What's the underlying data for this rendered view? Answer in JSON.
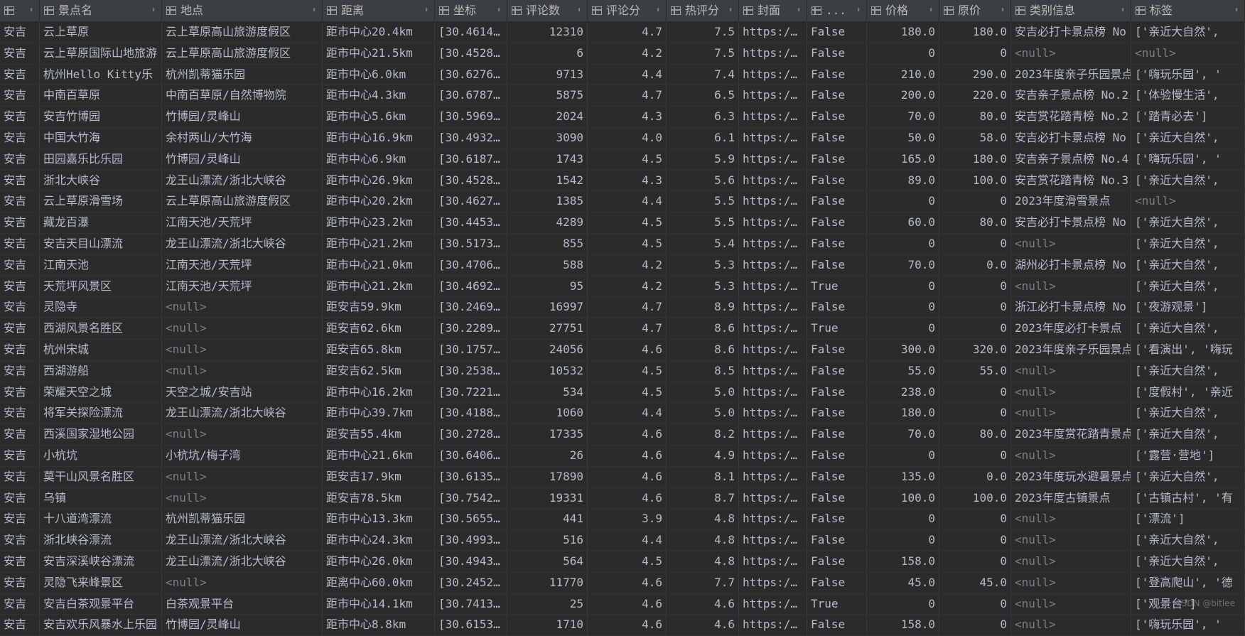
{
  "columns": [
    {
      "label": "",
      "icon": "table-icon"
    },
    {
      "label": "景点名",
      "icon": "column-icon"
    },
    {
      "label": "地点",
      "icon": "column-icon"
    },
    {
      "label": "距离",
      "icon": "column-icon"
    },
    {
      "label": "坐标",
      "icon": "column-icon"
    },
    {
      "label": "评论数",
      "icon": "column-icon"
    },
    {
      "label": "评论分",
      "icon": "column-icon"
    },
    {
      "label": "热评分",
      "icon": "column-icon"
    },
    {
      "label": "封面",
      "icon": "column-icon"
    },
    {
      "label": "...",
      "icon": "column-icon"
    },
    {
      "label": "价格",
      "icon": "column-icon"
    },
    {
      "label": "原价",
      "icon": "column-icon"
    },
    {
      "label": "类别信息",
      "icon": "column-icon"
    },
    {
      "label": "标签",
      "icon": "column-icon"
    }
  ],
  "numeric_columns": [
    5,
    6,
    7,
    10,
    11
  ],
  "null_text": "<null>",
  "rows": [
    [
      "安吉",
      "云上草原",
      "云上草原高山旅游度假区",
      "距市中心20.4km",
      "[30.4614…",
      "12310",
      "4.7",
      "7.5",
      "https:/…",
      "False",
      "180.0",
      "180.0",
      "安吉必打卡景点榜 No",
      "['亲近大自然',"
    ],
    [
      "安吉",
      "云上草原国际山地旅游",
      "云上草原高山旅游度假区",
      "距市中心21.5km",
      "[30.4528…",
      "6",
      "4.2",
      "7.5",
      "https:/…",
      "False",
      "0",
      "0",
      "<null>",
      "<null>"
    ],
    [
      "安吉",
      "杭州Hello Kitty乐",
      "杭州凯蒂猫乐园",
      "距市中心6.0km",
      "[30.6276…",
      "9713",
      "4.4",
      "7.4",
      "https:/…",
      "False",
      "210.0",
      "290.0",
      "2023年度亲子乐园景点",
      "['嗨玩乐园', '"
    ],
    [
      "安吉",
      "中南百草原",
      "中南百草原/自然博物院",
      "距市中心4.3km",
      "[30.6787…",
      "5875",
      "4.7",
      "6.5",
      "https:/…",
      "False",
      "200.0",
      "220.0",
      "安吉亲子景点榜 No.2",
      "['体验慢生活',"
    ],
    [
      "安吉",
      "安吉竹博园",
      "竹博园/灵峰山",
      "距市中心5.6km",
      "[30.5969…",
      "2024",
      "4.3",
      "6.3",
      "https:/…",
      "False",
      "70.0",
      "80.0",
      "安吉赏花踏青榜 No.2",
      "['踏青必去']"
    ],
    [
      "安吉",
      "中国大竹海",
      "余村两山/大竹海",
      "距市中心16.9km",
      "[30.4932…",
      "3090",
      "4.0",
      "6.1",
      "https:/…",
      "False",
      "50.0",
      "58.0",
      "安吉必打卡景点榜 No",
      "['亲近大自然',"
    ],
    [
      "安吉",
      "田园嘉乐比乐园",
      "竹博园/灵峰山",
      "距市中心6.9km",
      "[30.6187…",
      "1743",
      "4.5",
      "5.9",
      "https:/…",
      "False",
      "165.0",
      "180.0",
      "安吉亲子景点榜 No.4",
      "['嗨玩乐园', '"
    ],
    [
      "安吉",
      "浙北大峡谷",
      "龙王山漂流/浙北大峡谷",
      "距市中心26.9km",
      "[30.4528…",
      "1542",
      "4.3",
      "5.6",
      "https:/…",
      "False",
      "89.0",
      "100.0",
      "安吉赏花踏青榜 No.3",
      "['亲近大自然',"
    ],
    [
      "安吉",
      "云上草原滑雪场",
      "云上草原高山旅游度假区",
      "距市中心20.2km",
      "[30.4627…",
      "1385",
      "4.4",
      "5.5",
      "https:/…",
      "False",
      "0",
      "0",
      "2023年度滑雪景点",
      "<null>"
    ],
    [
      "安吉",
      "藏龙百瀑",
      "江南天池/天荒坪",
      "距市中心23.2km",
      "[30.4453…",
      "4289",
      "4.5",
      "5.5",
      "https:/…",
      "False",
      "60.0",
      "80.0",
      "安吉必打卡景点榜 No",
      "['亲近大自然',"
    ],
    [
      "安吉",
      "安吉天目山漂流",
      "龙王山漂流/浙北大峡谷",
      "距市中心21.2km",
      "[30.5173…",
      "855",
      "4.5",
      "5.4",
      "https:/…",
      "False",
      "0",
      "0",
      "<null>",
      "['亲近大自然',"
    ],
    [
      "安吉",
      "江南天池",
      "江南天池/天荒坪",
      "距市中心21.0km",
      "[30.4706…",
      "588",
      "4.2",
      "5.3",
      "https:/…",
      "False",
      "70.0",
      "0.0",
      "湖州必打卡景点榜 No",
      "['亲近大自然',"
    ],
    [
      "安吉",
      "天荒坪风景区",
      "江南天池/天荒坪",
      "距市中心21.2km",
      "[30.4692…",
      "95",
      "4.2",
      "5.3",
      "https:/…",
      "True",
      "0",
      "0",
      "<null>",
      "['亲近大自然',"
    ],
    [
      "安吉",
      "灵隐寺",
      "<null>",
      "距安吉59.9km",
      "[30.2469…",
      "16997",
      "4.7",
      "8.9",
      "https:/…",
      "False",
      "0",
      "0",
      "浙江必打卡景点榜 No",
      "['夜游观景']"
    ],
    [
      "安吉",
      "西湖风景名胜区",
      "<null>",
      "距安吉62.6km",
      "[30.2289…",
      "27751",
      "4.7",
      "8.6",
      "https:/…",
      "True",
      "0",
      "0",
      "2023年度必打卡景点",
      "['亲近大自然',"
    ],
    [
      "安吉",
      "杭州宋城",
      "<null>",
      "距安吉65.8km",
      "[30.1757…",
      "24056",
      "4.6",
      "8.6",
      "https:/…",
      "False",
      "300.0",
      "320.0",
      "2023年度亲子乐园景点",
      "['看演出', '嗨玩"
    ],
    [
      "安吉",
      "西湖游船",
      "<null>",
      "距安吉62.5km",
      "[30.2538…",
      "10532",
      "4.5",
      "8.5",
      "https:/…",
      "False",
      "55.0",
      "55.0",
      "<null>",
      "['亲近大自然',"
    ],
    [
      "安吉",
      "荣耀天空之城",
      "天空之城/安吉站",
      "距市中心16.2km",
      "[30.7221…",
      "534",
      "4.5",
      "5.0",
      "https:/…",
      "False",
      "238.0",
      "0",
      "<null>",
      "['度假村', '亲近"
    ],
    [
      "安吉",
      "将军关探险漂流",
      "龙王山漂流/浙北大峡谷",
      "距市中心39.7km",
      "[30.4188…",
      "1060",
      "4.4",
      "5.0",
      "https:/…",
      "False",
      "180.0",
      "0",
      "<null>",
      "['亲近大自然',"
    ],
    [
      "安吉",
      "西溪国家湿地公园",
      "<null>",
      "距安吉55.4km",
      "[30.2728…",
      "17335",
      "4.6",
      "8.2",
      "https:/…",
      "False",
      "70.0",
      "80.0",
      "2023年度赏花踏青景点",
      "['亲近大自然',"
    ],
    [
      "安吉",
      "小杭坑",
      "小杭坑/梅子湾",
      "距市中心21.6km",
      "[30.6406…",
      "26",
      "4.6",
      "4.9",
      "https:/…",
      "False",
      "0",
      "0",
      "<null>",
      "['露营·营地']"
    ],
    [
      "安吉",
      "莫干山风景名胜区",
      "<null>",
      "距安吉17.9km",
      "[30.6135…",
      "17890",
      "4.6",
      "8.1",
      "https:/…",
      "False",
      "135.0",
      "0.0",
      "2023年度玩水避暑景点",
      "['亲近大自然',"
    ],
    [
      "安吉",
      "乌镇",
      "<null>",
      "距安吉78.5km",
      "[30.7542…",
      "19331",
      "4.6",
      "8.7",
      "https:/…",
      "False",
      "100.0",
      "100.0",
      "2023年度古镇景点",
      "['古镇古村', '有"
    ],
    [
      "安吉",
      "十八道湾漂流",
      "杭州凯蒂猫乐园",
      "距市中心13.3km",
      "[30.5655…",
      "441",
      "3.9",
      "4.8",
      "https:/…",
      "False",
      "0",
      "0",
      "<null>",
      "['漂流']"
    ],
    [
      "安吉",
      "浙北峡谷漂流",
      "龙王山漂流/浙北大峡谷",
      "距市中心24.3km",
      "[30.4993…",
      "516",
      "4.4",
      "4.8",
      "https:/…",
      "False",
      "0",
      "0",
      "<null>",
      "['亲近大自然',"
    ],
    [
      "安吉",
      "安吉深溪峡谷漂流",
      "龙王山漂流/浙北大峡谷",
      "距市中心26.0km",
      "[30.4943…",
      "564",
      "4.5",
      "4.8",
      "https:/…",
      "False",
      "158.0",
      "0",
      "<null>",
      "['亲近大自然',"
    ],
    [
      "安吉",
      "灵隐飞来峰景区",
      "<null>",
      "距离中心60.0km",
      "[30.2452…",
      "11770",
      "4.6",
      "7.7",
      "https:/…",
      "False",
      "45.0",
      "45.0",
      "<null>",
      "['登高爬山', '德"
    ],
    [
      "安吉",
      "安吉白茶观景平台",
      "白茶观景平台",
      "距市中心14.1km",
      "[30.7413…",
      "25",
      "4.6",
      "4.6",
      "https:/…",
      "True",
      "0",
      "0",
      "<null>",
      "['观景台']"
    ],
    [
      "安吉",
      "安吉欢乐风暴水上乐园",
      "竹博园/灵峰山",
      "距市中心8.8km",
      "[30.6153…",
      "1710",
      "4.6",
      "4.6",
      "https:/…",
      "False",
      "158.0",
      "0",
      "<null>",
      "['嗨玩乐园', '"
    ]
  ],
  "watermark": "CSDN @bitlee"
}
